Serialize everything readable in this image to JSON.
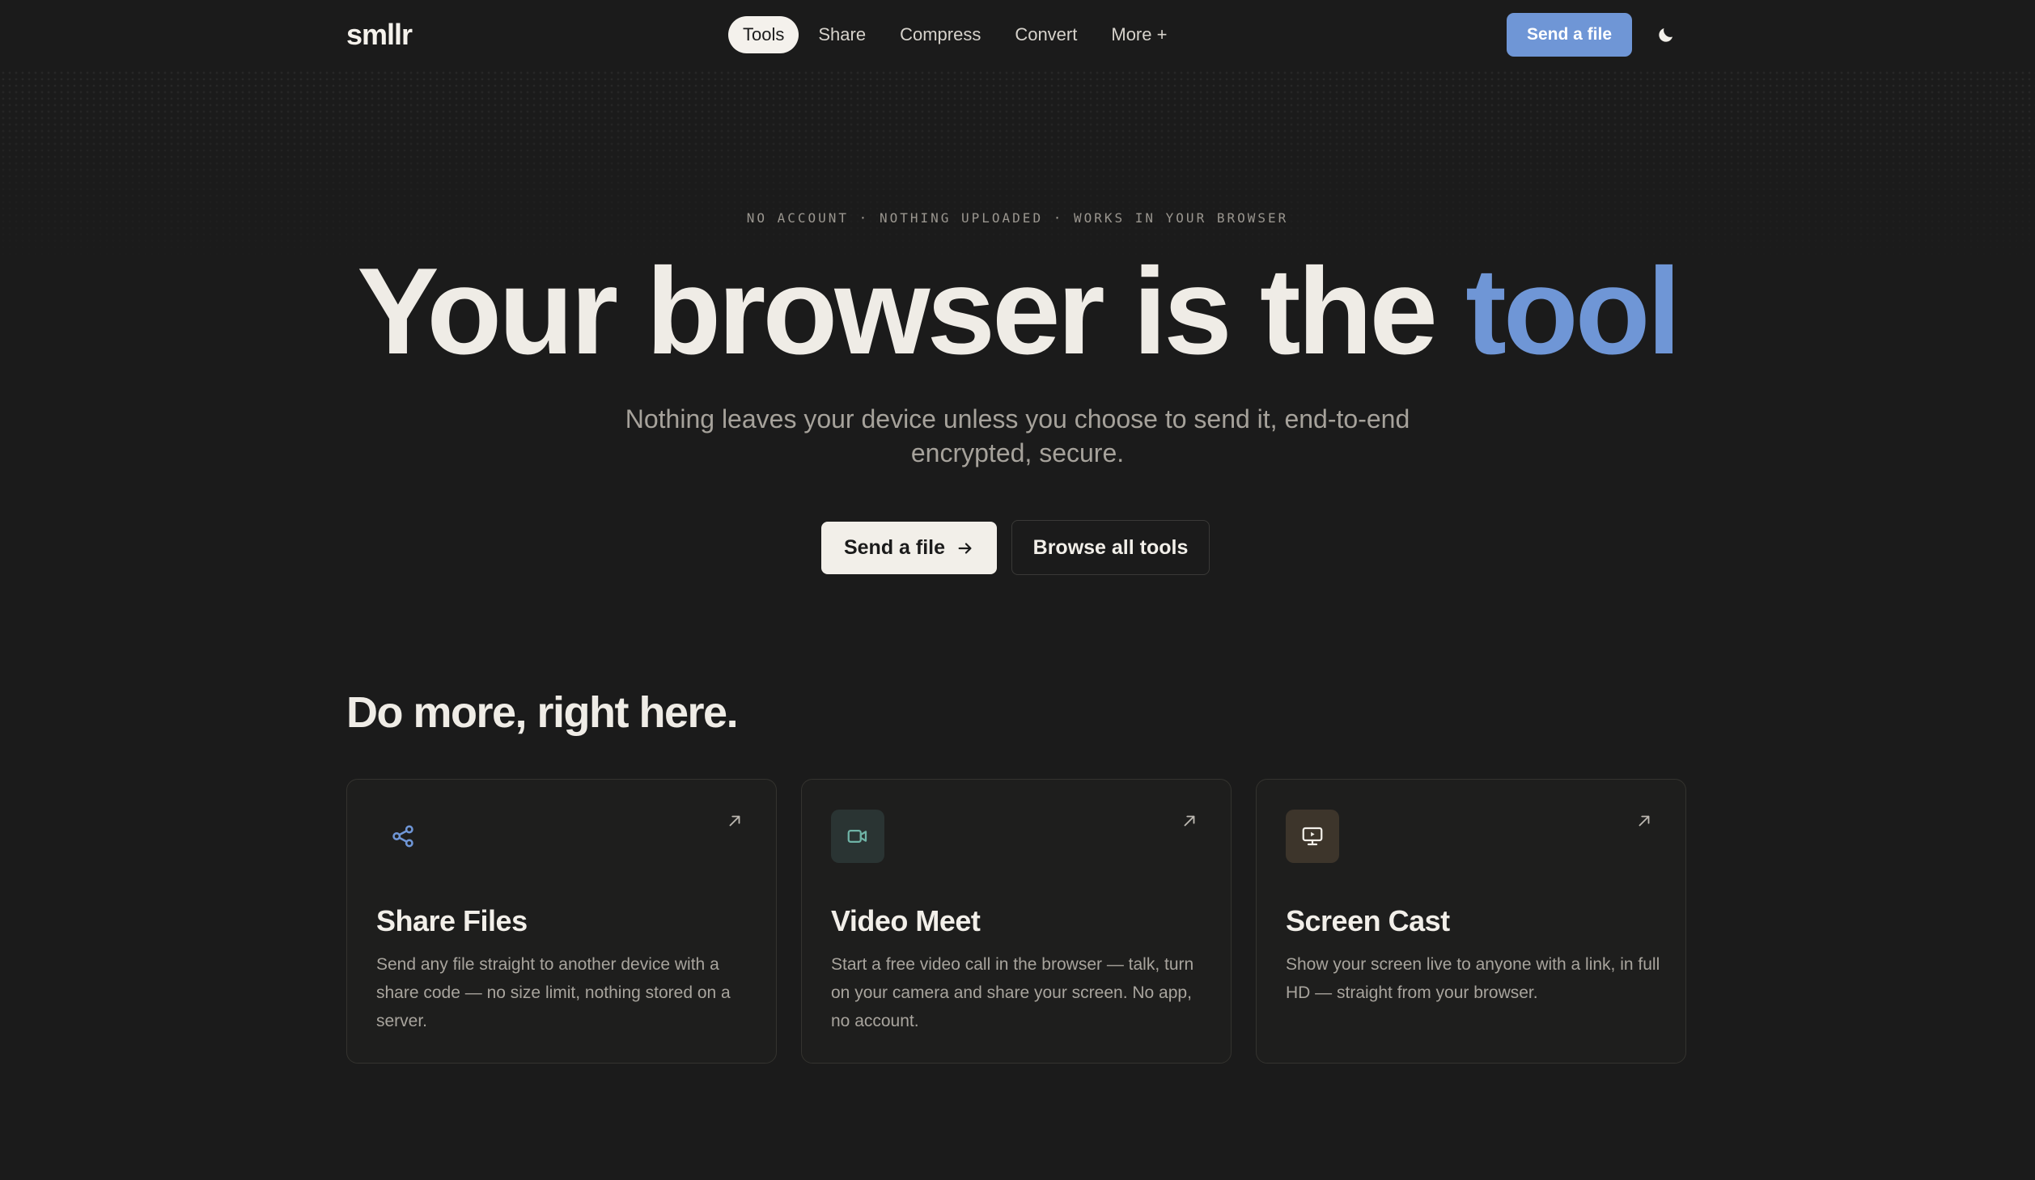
{
  "header": {
    "logo": "smllr",
    "nav": [
      {
        "label": "Tools",
        "active": true
      },
      {
        "label": "Share",
        "active": false
      },
      {
        "label": "Compress",
        "active": false
      },
      {
        "label": "Convert",
        "active": false
      },
      {
        "label": "More +",
        "active": false
      }
    ],
    "cta_label": "Send a file",
    "theme_icon": "moon-icon"
  },
  "hero": {
    "eyebrow": "NO ACCOUNT · NOTHING UPLOADED · WORKS IN YOUR BROWSER",
    "headline_main": "Your browser is the ",
    "headline_accent": "tool",
    "subhead": "Nothing leaves your device unless you choose to send it, end-to-end encrypted, secure.",
    "primary_label": "Send a file",
    "primary_icon": "arrow-right-icon",
    "secondary_label": "Browse all tools"
  },
  "section": {
    "title": "Do more, right here.",
    "cards": [
      {
        "title": "Share Files",
        "description": "Send any file straight to another device with a share code — no size limit, nothing stored on a server.",
        "icon": "share-icon"
      },
      {
        "title": "Video Meet",
        "description": "Start a free video call in the browser — talk, turn on your camera and share your screen. No app, no account.",
        "icon": "video-camera-icon"
      },
      {
        "title": "Screen Cast",
        "description": "Show your screen live to anyone with a link, in full HD — straight from your browser.",
        "icon": "screen-cast-icon"
      }
    ]
  },
  "colors": {
    "background": "#1b1b1b",
    "accent": "#6f96d6",
    "text": "#f2efe9",
    "muted": "#a6a29b"
  }
}
